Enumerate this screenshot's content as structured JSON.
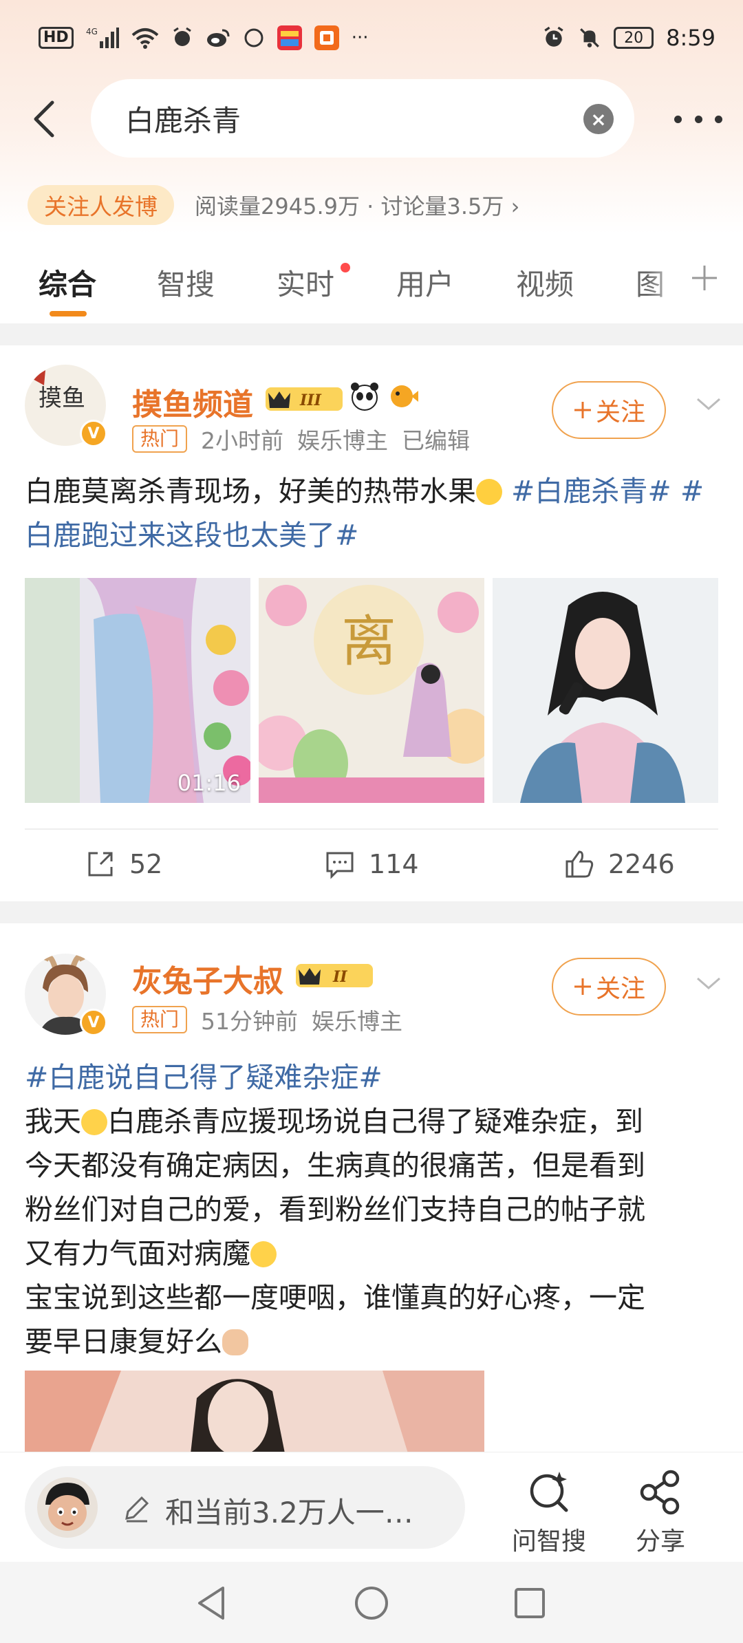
{
  "status_bar": {
    "time": "8:59",
    "signal_label": "HD",
    "network": "4G",
    "battery": "20",
    "icons": [
      "hd-icon",
      "signal-icon",
      "wifi-icon",
      "alarm-icon",
      "weibo-icon",
      "circle-icon",
      "app-icon",
      "app-icon-2",
      "more-dots-icon",
      "alarm-icon",
      "mute-icon",
      "battery-icon"
    ],
    "more": "···"
  },
  "search": {
    "query": "白鹿杀青"
  },
  "topic_bar": {
    "follow_post_label": "关注人发博",
    "stats": "阅读量2945.9万 · 讨论量3.5万",
    "stats_chevron": "›"
  },
  "tabs": [
    {
      "label": "综合",
      "active": true
    },
    {
      "label": "智搜",
      "active": false
    },
    {
      "label": "实时",
      "active": false,
      "red_dot": true
    },
    {
      "label": "用户",
      "active": false
    },
    {
      "label": "视频",
      "active": false
    },
    {
      "label": "图",
      "active": false
    }
  ],
  "posts": [
    {
      "username": "摸鱼频道",
      "level": "III",
      "avatar_text": "摸鱼",
      "hot_tag": "热门",
      "time": "2小时前",
      "role": "娱乐博主",
      "edited": "已编辑",
      "follow_label": "关注",
      "text_before": "白鹿莫离杀青现场，好美的热带水果",
      "hashtag_1": "#白鹿杀青#",
      "hashtag_2": "#白鹿跑过来这段也太美了#",
      "video_duration": "01:16",
      "reposts": "52",
      "comments": "114",
      "likes": "2246"
    },
    {
      "username": "灰兔子大叔",
      "level": "II",
      "hot_tag": "热门",
      "time": "51分钟前",
      "role": "娱乐博主",
      "follow_label": "关注",
      "hashtag_1": "#白鹿说自己得了疑难杂症#",
      "line_1a": "我天",
      "line_1b": "白鹿杀青应援现场说自己得了疑难杂症，到",
      "line_2": "今天都没有确定病因，生病真的很痛苦，但是看到",
      "line_3": "粉丝们对自己的爱，看到粉丝们支持自己的帖子就",
      "line_4": "又有力气面对病魔",
      "line_5": "宝宝说到这些都一度哽咽，谁懂真的好心疼，一定",
      "line_6": "要早日康复好么"
    }
  ],
  "bottom_bar": {
    "comment_placeholder": "和当前3.2万人一…",
    "ask_label": "问智搜",
    "share_label": "分享"
  }
}
